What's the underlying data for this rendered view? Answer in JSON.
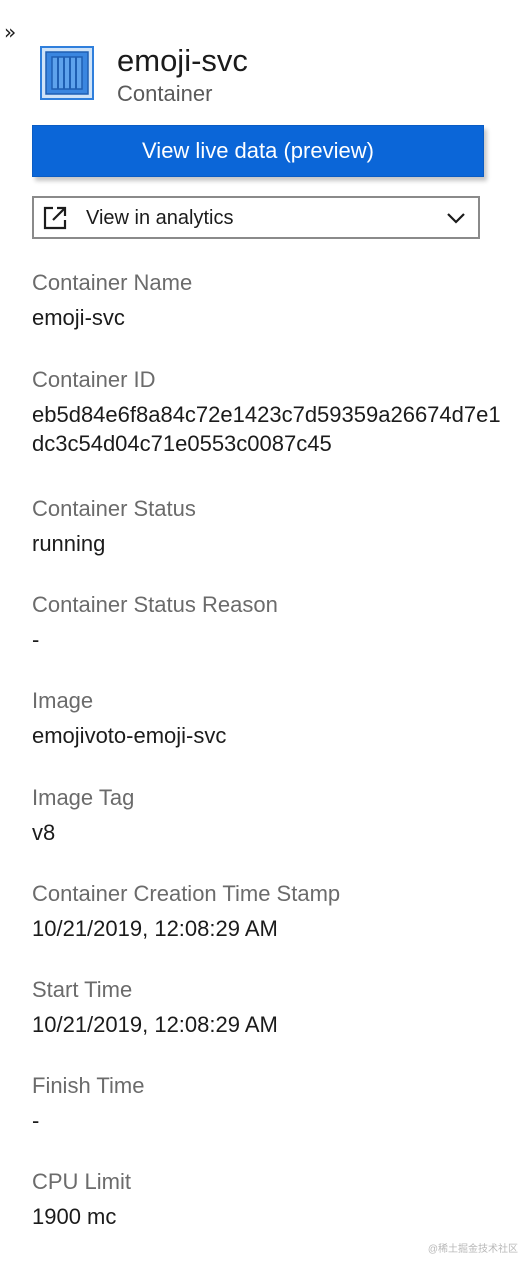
{
  "panel": {
    "collapse_glyph": "»"
  },
  "header": {
    "icon": "container-icon",
    "title": "emoji-svc",
    "subtitle": "Container"
  },
  "actions": {
    "live_button_label": "View live data (preview)",
    "analytics_label": "View in analytics",
    "analytics_icon": "external-link-icon",
    "analytics_chevron": "chevron-down-icon"
  },
  "properties": [
    {
      "label": "Container Name",
      "value": "emoji-svc"
    },
    {
      "label": "Container ID",
      "value": "eb5d84e6f8a84c72e1423c7d59359a26674d7e1dc3c54d04c71e0553c0087c45"
    },
    {
      "label": "Container Status",
      "value": "running"
    },
    {
      "label": "Container Status Reason",
      "value": "-"
    },
    {
      "label": "Image",
      "value": "emojivoto-emoji-svc"
    },
    {
      "label": "Image Tag",
      "value": "v8"
    },
    {
      "label": "Container Creation Time Stamp",
      "value": "10/21/2019, 12:08:29 AM"
    },
    {
      "label": "Start Time",
      "value": "10/21/2019, 12:08:29 AM"
    },
    {
      "label": "Finish Time",
      "value": "-"
    },
    {
      "label": "CPU Limit",
      "value": "1900 mc"
    }
  ],
  "watermark": "@稀土掘金技术社区",
  "colors": {
    "accent": "#0b66d8",
    "icon_blue": "#2f7fdc",
    "label_gray": "#6b6b6b"
  }
}
